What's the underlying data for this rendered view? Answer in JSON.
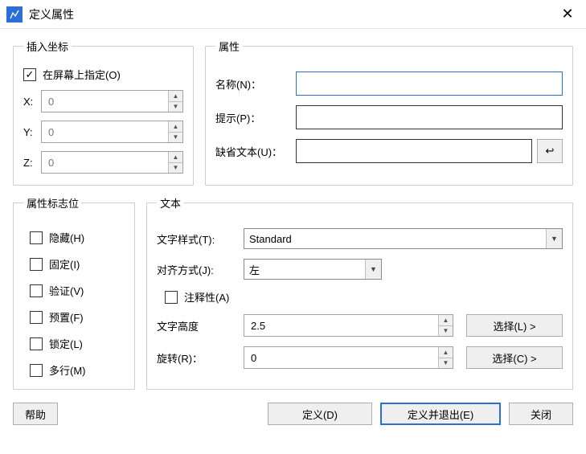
{
  "window": {
    "title": "定义属性"
  },
  "insertCoord": {
    "legend": "插入坐标",
    "specifyOnScreen": {
      "label": "在屏幕上指定(O)",
      "checked": true
    },
    "x_label": "X:",
    "x_value": "0",
    "y_label": "Y:",
    "y_value": "0",
    "z_label": "Z:",
    "z_value": "0"
  },
  "attr": {
    "legend": "属性",
    "name_label": "名称(N)：",
    "name_value": "",
    "prompt_label": "提示(P)：",
    "prompt_value": "",
    "default_label": "缺省文本(U)：",
    "default_value": "",
    "insert_icon": "↩"
  },
  "flags": {
    "legend": "属性标志位",
    "hidden": "隐藏(H)",
    "fixed": "固定(I)",
    "verify": "验证(V)",
    "preset": "预置(F)",
    "lock": "锁定(L)",
    "multi": "多行(M)"
  },
  "text": {
    "legend": "文本",
    "style_label": "文字样式(T):",
    "style_value": "Standard",
    "justify_label": "对齐方式(J):",
    "justify_value": "左",
    "annotative_label": "注释性(A)",
    "height_label": "文字高度",
    "height_value": "2.5",
    "height_btn": "选择(L) >",
    "rotation_label": "旋转(R)：",
    "rotation_value": "0",
    "rotation_btn": "选择(C) >"
  },
  "buttons": {
    "help": "帮助",
    "define": "定义(D)",
    "defineExit": "定义并退出(E)",
    "close": "关闭"
  }
}
